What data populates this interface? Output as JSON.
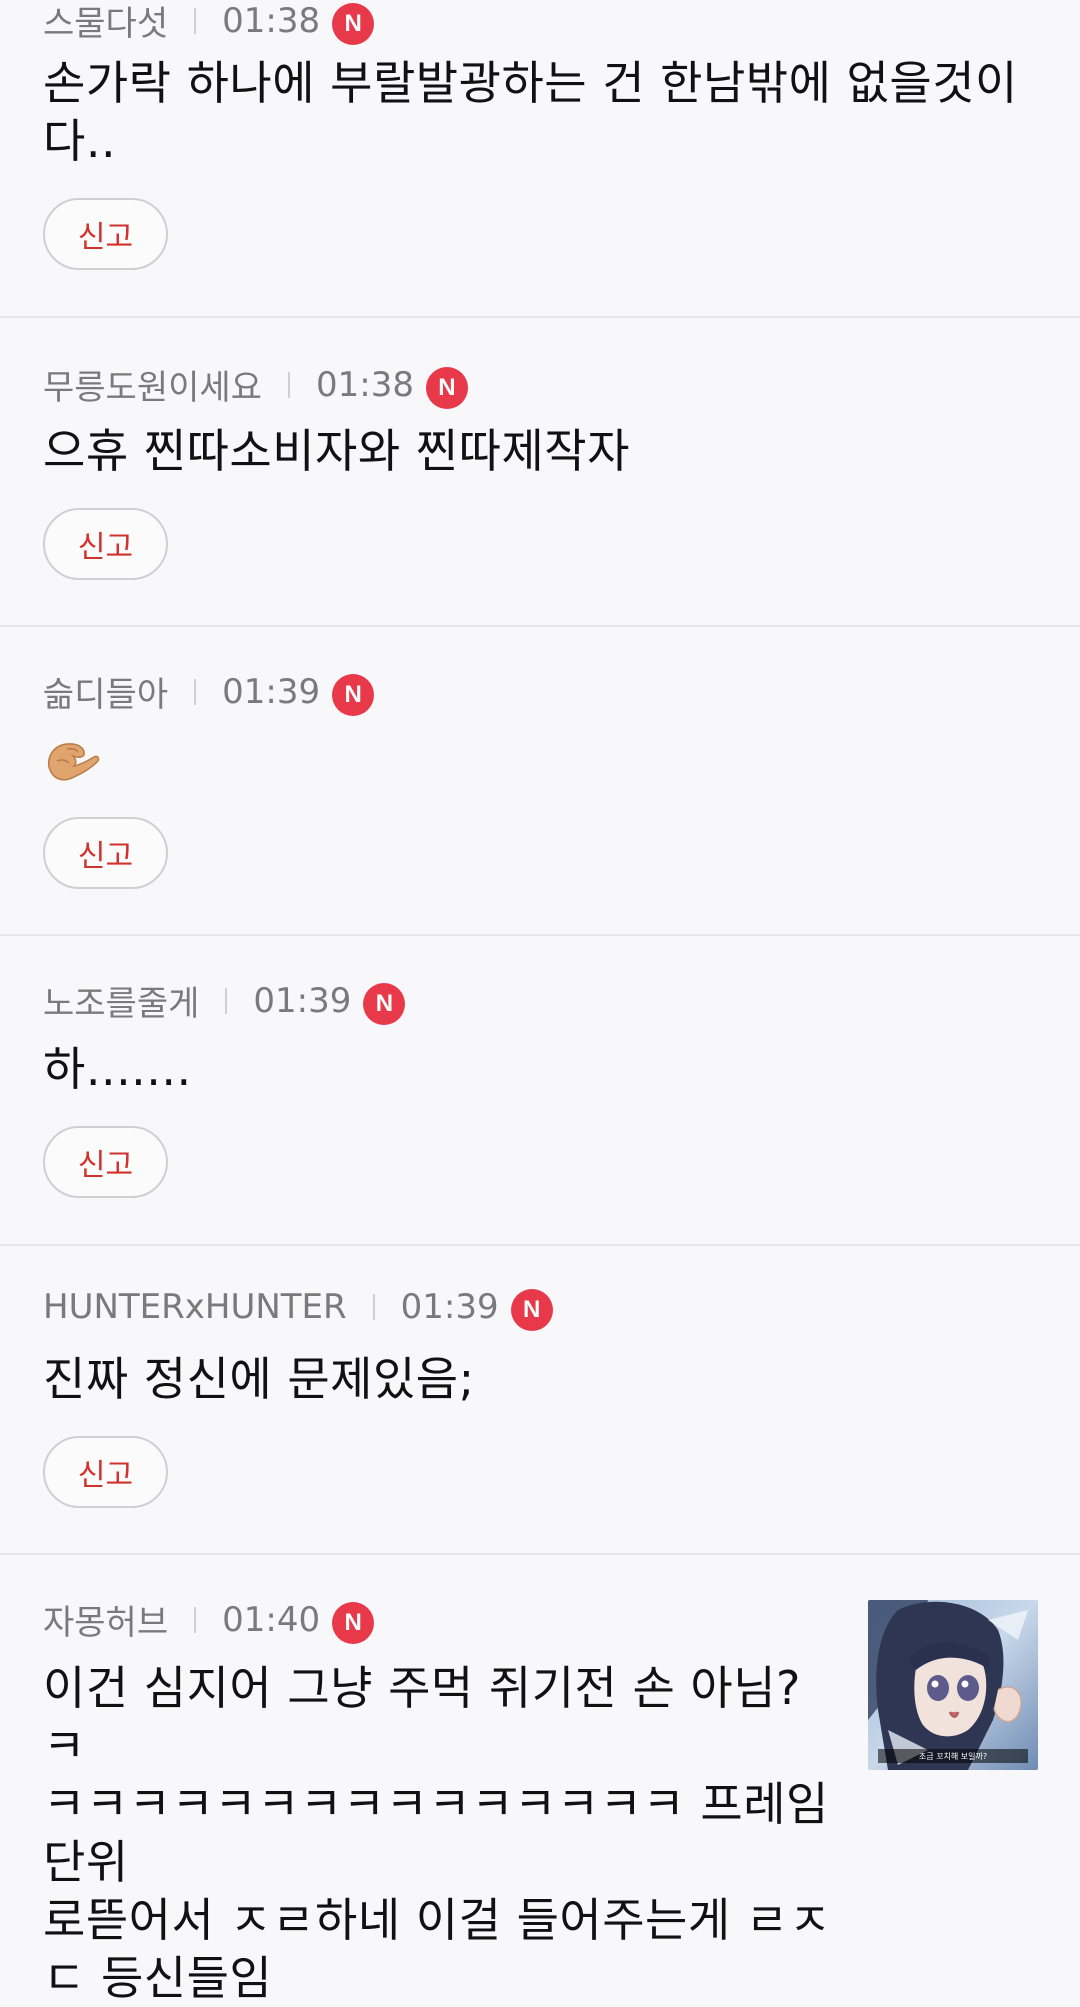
{
  "comments": [
    {
      "author": "스물다섯",
      "time": "01:38",
      "badge": "N",
      "text_lines": [
        "손가락 하나에 부랄발광하는 건 한남밖에 없을것이",
        "다.."
      ],
      "report": "신고"
    },
    {
      "author": "무릉도원이세요",
      "time": "01:38",
      "badge": "N",
      "text_lines": [
        "으휴 찐따소비자와 찐따제작자"
      ],
      "report": "신고"
    },
    {
      "author": "슮디들아",
      "time": "01:39",
      "badge": "N",
      "emoji_icon": "pinching-hand-icon",
      "report": "신고"
    },
    {
      "author": "노조를줄게",
      "time": "01:39",
      "badge": "N",
      "text_lines": [
        "하......."
      ],
      "report": "신고"
    },
    {
      "author": "HUNTERxHUNTER",
      "time": "01:39",
      "badge": "N",
      "text_lines": [
        "진짜 정신에 문제있음;"
      ],
      "report": "신고"
    },
    {
      "author": "자몽허브",
      "time": "01:40",
      "badge": "N",
      "text_lines": [
        "이건 심지어 그냥 주먹 쥐기전 손 아님? ㅋ",
        "ㅋㅋㅋㅋㅋㅋㅋㅋㅋㅋㅋㅋㅋㅋㅋ 프레임단위",
        "로뜯어서 ㅈㄹ하네 이걸 들어주는게 ㄹㅈ",
        "ㄷ 등신들임"
      ],
      "thumbnail_caption": "조금 꼬치해 보일까?"
    }
  ],
  "colors": {
    "badge": "#e8394a",
    "report_text": "#d0322e",
    "meta_text": "#7a7a7a"
  }
}
